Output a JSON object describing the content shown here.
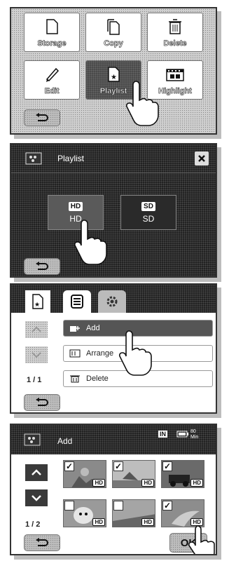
{
  "menu_screen": {
    "tiles": [
      {
        "label": "Storage",
        "icon": "storage-icon"
      },
      {
        "label": "Copy",
        "icon": "copy-icon"
      },
      {
        "label": "Delete",
        "icon": "trash-icon"
      },
      {
        "label": "Edit",
        "icon": "pencil-icon"
      },
      {
        "label": "Playlist",
        "icon": "playlist-icon"
      },
      {
        "label": "Highlight",
        "icon": "film-icon"
      }
    ],
    "selected": "Playlist"
  },
  "playlist_screen": {
    "title": "Playlist",
    "options": [
      {
        "badge": "HD",
        "label": "HD"
      },
      {
        "badge": "SD",
        "label": "SD"
      }
    ]
  },
  "edit_screen": {
    "tabs": [
      "playlist-tab",
      "menu-tab",
      "settings-tab"
    ],
    "items": [
      {
        "label": "Add",
        "icon": "add-icon"
      },
      {
        "label": "Arrange",
        "icon": "arrange-icon"
      },
      {
        "label": "Delete",
        "icon": "delete-icon"
      }
    ],
    "page": "1 / 1"
  },
  "add_screen": {
    "title": "Add",
    "status": {
      "storage": "IN",
      "battery_time": "80 Min"
    },
    "page": "1 / 2",
    "thumbnails": [
      {
        "checked": true,
        "badge": "HD"
      },
      {
        "checked": true,
        "badge": "HD"
      },
      {
        "checked": true,
        "badge": "HD"
      },
      {
        "checked": false,
        "badge": "HD"
      },
      {
        "checked": false,
        "badge": "HD"
      },
      {
        "checked": true,
        "badge": "HD"
      }
    ],
    "ok_label": "OK"
  }
}
